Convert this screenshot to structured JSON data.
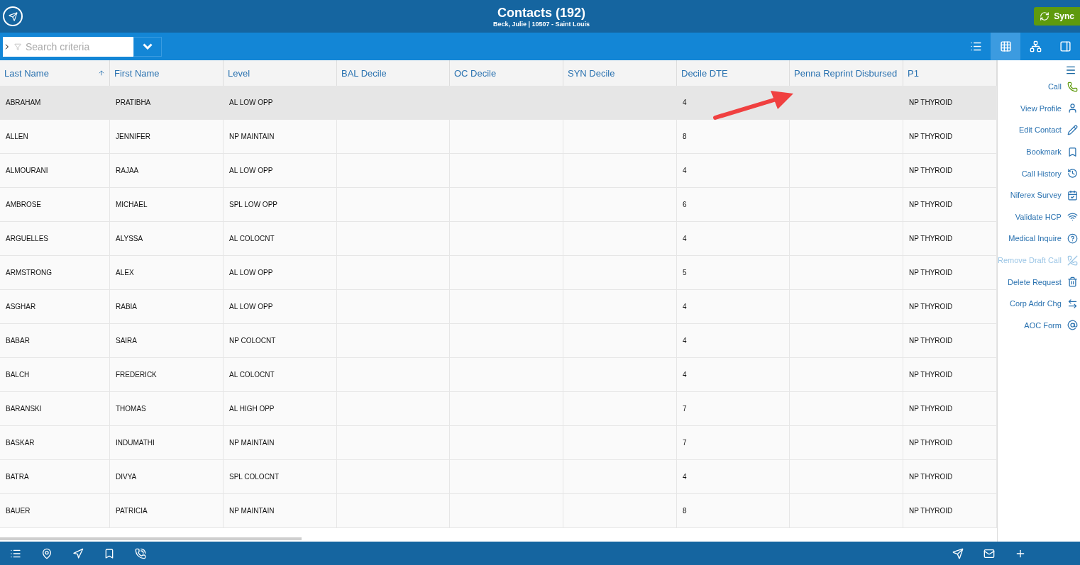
{
  "header": {
    "title": "Contacts (192)",
    "subtitle": "Beck, Julie | 10507 - Saint Louis",
    "sync_label": "Sync"
  },
  "toolbar": {
    "search": {
      "placeholder": "Search criteria"
    },
    "views": [
      {
        "kind": "list",
        "selected": false
      },
      {
        "kind": "grid",
        "selected": true
      },
      {
        "kind": "tree",
        "selected": false
      },
      {
        "kind": "panel",
        "selected": false
      }
    ]
  },
  "table": {
    "columns": [
      {
        "label": "Last Name",
        "sorted": true
      },
      {
        "label": "First Name",
        "sorted": false
      },
      {
        "label": "Level",
        "sorted": false
      },
      {
        "label": "BAL Decile",
        "sorted": false
      },
      {
        "label": "OC Decile",
        "sorted": false
      },
      {
        "label": "SYN Decile",
        "sorted": false
      },
      {
        "label": "Decile DTE",
        "sorted": false
      },
      {
        "label": "Penna Reprint Disbursed",
        "sorted": false
      },
      {
        "label": "P1",
        "sorted": false
      }
    ],
    "rows": [
      {
        "selected": true,
        "cells": [
          "ABRAHAM",
          "PRATIBHA",
          "AL LOW OPP",
          "",
          "",
          "",
          "4",
          "",
          "NP THYROID"
        ]
      },
      {
        "selected": false,
        "cells": [
          "ALLEN",
          "JENNIFER",
          "NP MAINTAIN",
          "",
          "",
          "",
          "8",
          "",
          "NP THYROID"
        ]
      },
      {
        "selected": false,
        "cells": [
          "ALMOURANI",
          "RAJAA",
          "AL LOW OPP",
          "",
          "",
          "",
          "4",
          "",
          "NP THYROID"
        ]
      },
      {
        "selected": false,
        "cells": [
          "AMBROSE",
          "MICHAEL",
          "SPL LOW OPP",
          "",
          "",
          "",
          "6",
          "",
          "NP THYROID"
        ]
      },
      {
        "selected": false,
        "cells": [
          "ARGUELLES",
          "ALYSSA",
          "AL COLOCNT",
          "",
          "",
          "",
          "4",
          "",
          "NP THYROID"
        ]
      },
      {
        "selected": false,
        "cells": [
          "ARMSTRONG",
          "ALEX",
          "AL LOW OPP",
          "",
          "",
          "",
          "5",
          "",
          "NP THYROID"
        ]
      },
      {
        "selected": false,
        "cells": [
          "ASGHAR",
          "RABIA",
          "AL LOW OPP",
          "",
          "",
          "",
          "4",
          "",
          "NP THYROID"
        ]
      },
      {
        "selected": false,
        "cells": [
          "BABAR",
          "SAIRA",
          "NP COLOCNT",
          "",
          "",
          "",
          "4",
          "",
          "NP THYROID"
        ]
      },
      {
        "selected": false,
        "cells": [
          "BALCH",
          "FREDERICK",
          "AL COLOCNT",
          "",
          "",
          "",
          "4",
          "",
          "NP THYROID"
        ]
      },
      {
        "selected": false,
        "cells": [
          "BARANSKI",
          "THOMAS",
          "AL HIGH OPP",
          "",
          "",
          "",
          "7",
          "",
          "NP THYROID"
        ]
      },
      {
        "selected": false,
        "cells": [
          "BASKAR",
          "INDUMATHI",
          "NP MAINTAIN",
          "",
          "",
          "",
          "7",
          "",
          "NP THYROID"
        ]
      },
      {
        "selected": false,
        "cells": [
          "BATRA",
          "DIVYA",
          "SPL COLOCNT",
          "",
          "",
          "",
          "4",
          "",
          "NP THYROID"
        ]
      },
      {
        "selected": false,
        "cells": [
          "BAUER",
          "PATRICIA",
          "NP MAINTAIN",
          "",
          "",
          "",
          "8",
          "",
          "NP THYROID"
        ]
      }
    ]
  },
  "actions": [
    {
      "label": "Call",
      "kind": "phone",
      "disabled": false
    },
    {
      "label": "View Profile",
      "kind": "user",
      "disabled": false
    },
    {
      "label": "Edit Contact",
      "kind": "pencil",
      "disabled": false
    },
    {
      "label": "Bookmark",
      "kind": "bookmark",
      "disabled": false
    },
    {
      "label": "Call History",
      "kind": "history",
      "disabled": false
    },
    {
      "label": "Niferex Survey",
      "kind": "calendar",
      "disabled": false
    },
    {
      "label": "Validate HCP",
      "kind": "card-wifi",
      "disabled": false
    },
    {
      "label": "Medical Inquire",
      "kind": "card-question",
      "disabled": false
    },
    {
      "label": "Remove Draft Call",
      "kind": "phone-off",
      "disabled": true
    },
    {
      "label": "Delete Request",
      "kind": "card-trash",
      "disabled": false
    },
    {
      "label": "Corp Addr Chg",
      "kind": "card-swap",
      "disabled": false
    },
    {
      "label": "AOC Form",
      "kind": "card-at",
      "disabled": false
    }
  ]
}
